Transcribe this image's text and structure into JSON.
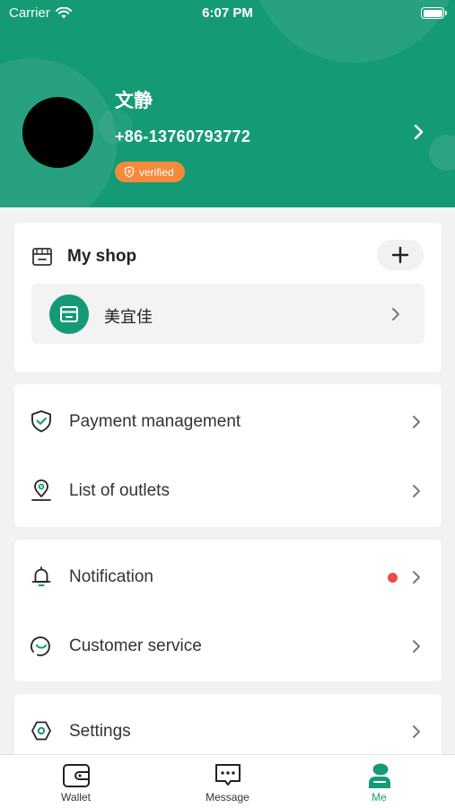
{
  "status_bar": {
    "carrier": "Carrier",
    "time": "6:07 PM"
  },
  "profile": {
    "name": "文静",
    "phone": "+86-13760793772",
    "badge": "verified"
  },
  "shop": {
    "title": "My shop",
    "items": [
      {
        "name": "美宜佳"
      }
    ]
  },
  "menu": {
    "group1": [
      {
        "label": "Payment management",
        "icon": "shield-check-icon"
      },
      {
        "label": "List of outlets",
        "icon": "location-pin-icon"
      }
    ],
    "group2": [
      {
        "label": "Notification",
        "icon": "bell-icon",
        "unread": true
      },
      {
        "label": "Customer service",
        "icon": "headset-icon"
      }
    ],
    "group3": [
      {
        "label": "Settings",
        "icon": "settings-hexagon-icon"
      }
    ]
  },
  "tabs": [
    {
      "label": "Wallet",
      "icon": "wallet-icon"
    },
    {
      "label": "Message",
      "icon": "message-icon"
    },
    {
      "label": "Me",
      "icon": "person-icon",
      "active": true
    }
  ],
  "colors": {
    "brand": "#159a76",
    "badge": "#f58a3a",
    "dot": "#f04848"
  }
}
